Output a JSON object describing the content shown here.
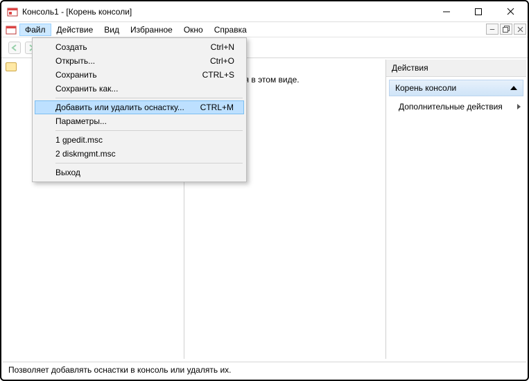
{
  "window": {
    "title": "Консоль1 - [Корень консоли]"
  },
  "menubar": {
    "file": "Файл",
    "action": "Действие",
    "view": "Вид",
    "favorites": "Избранное",
    "window": "Окно",
    "help": "Справка"
  },
  "file_menu": {
    "new": {
      "label": "Создать",
      "shortcut": "Ctrl+N"
    },
    "open": {
      "label": "Открыть...",
      "shortcut": "Ctrl+O"
    },
    "save": {
      "label": "Сохранить",
      "shortcut": "CTRL+S"
    },
    "save_as": {
      "label": "Сохранить как..."
    },
    "add_remove": {
      "label": "Добавить или удалить оснастку...",
      "shortcut": "CTRL+M"
    },
    "options": {
      "label": "Параметры..."
    },
    "recent1": {
      "label": "1 gpedit.msc"
    },
    "recent2": {
      "label": "2 diskmgmt.msc"
    },
    "exit": {
      "label": "Выход"
    }
  },
  "center": {
    "empty_text": "я отображения в этом виде."
  },
  "actions_pane": {
    "header": "Действия",
    "root": "Корень консоли",
    "more": "Дополнительные действия"
  },
  "statusbar": {
    "text": "Позволяет добавлять оснастки в консоль или удалять их."
  }
}
